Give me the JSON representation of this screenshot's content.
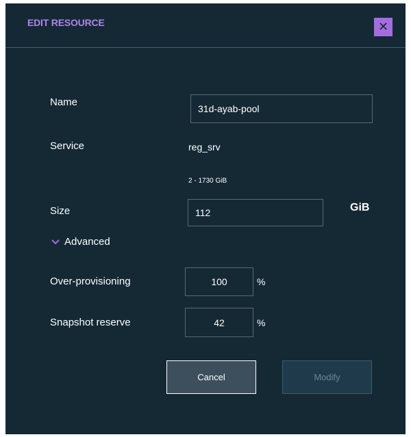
{
  "dialog": {
    "title": "EDIT RESOURCE",
    "close_icon": "close-icon",
    "close_glyph": "✕"
  },
  "form": {
    "name_label": "Name",
    "name_value": "31d-ayab-pool",
    "service_label": "Service",
    "service_value": "reg_srv",
    "size_range_hint": "2 - 1730 GiB",
    "size_label": "Size",
    "size_value": "112",
    "size_unit": "GiB",
    "advanced_label": "Advanced",
    "advanced_icon": "chevron-down-icon",
    "over_provisioning_label": "Over-provisioning",
    "over_provisioning_value": "100",
    "over_provisioning_unit": "%",
    "snapshot_reserve_label": "Snapshot reserve",
    "snapshot_reserve_value": "42",
    "snapshot_reserve_unit": "%"
  },
  "actions": {
    "cancel_label": "Cancel",
    "modify_label": "Modify"
  },
  "colors": {
    "background": "#152935",
    "accent": "#a36de0",
    "title": "#b084ec",
    "border": "#5a6872",
    "disabled_text": "#6f8592"
  }
}
